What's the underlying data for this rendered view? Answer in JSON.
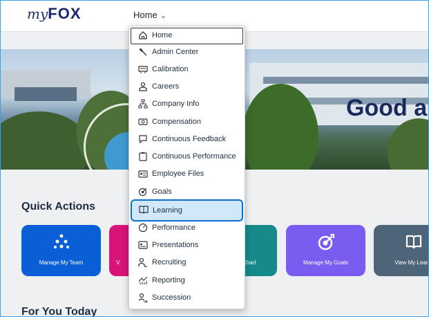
{
  "brand": {
    "logo_prefix": "my",
    "logo_main": "FOX"
  },
  "nav": {
    "home_label": "Home"
  },
  "hero": {
    "greeting_partial": "Good a"
  },
  "sections": {
    "quick_actions": "Quick Actions",
    "for_you_today": "For You Today"
  },
  "tiles": [
    {
      "label": "Manage My Team",
      "color": "#0b5fd6",
      "icon": "team-icon"
    },
    {
      "label": "V",
      "color": "#d8137a",
      "icon": "video-icon"
    },
    {
      "label": "Chart",
      "color": "#168a8a",
      "icon": "org-chart-icon"
    },
    {
      "label": "Manage My Goals",
      "color": "#7b5cf0",
      "icon": "goal-target-icon"
    },
    {
      "label": "View My Learni",
      "color": "#4e6479",
      "icon": "learning-book-icon"
    }
  ],
  "menu": {
    "items": [
      {
        "label": "Home",
        "icon": "home-icon"
      },
      {
        "label": "Admin Center",
        "icon": "wrench-icon"
      },
      {
        "label": "Calibration",
        "icon": "calibration-icon"
      },
      {
        "label": "Careers",
        "icon": "careers-icon"
      },
      {
        "label": "Company Info",
        "icon": "org-structure-icon"
      },
      {
        "label": "Compensation",
        "icon": "money-icon"
      },
      {
        "label": "Continuous Feedback",
        "icon": "feedback-icon"
      },
      {
        "label": "Continuous Performance",
        "icon": "clipboard-icon"
      },
      {
        "label": "Employee Files",
        "icon": "id-card-icon"
      },
      {
        "label": "Goals",
        "icon": "goal-icon"
      },
      {
        "label": "Learning",
        "icon": "learning-icon"
      },
      {
        "label": "Performance",
        "icon": "performance-icon"
      },
      {
        "label": "Presentations",
        "icon": "presentation-icon"
      },
      {
        "label": "Recruiting",
        "icon": "recruiting-icon"
      },
      {
        "label": "Reporting",
        "icon": "reporting-icon"
      },
      {
        "label": "Succession",
        "icon": "succession-icon"
      }
    ],
    "selected": "Learning",
    "focused": "Home"
  },
  "colors": {
    "accent": "#0a6ed1",
    "selected_bg": "#d1e8fa",
    "heading": "#1c2a5a"
  }
}
